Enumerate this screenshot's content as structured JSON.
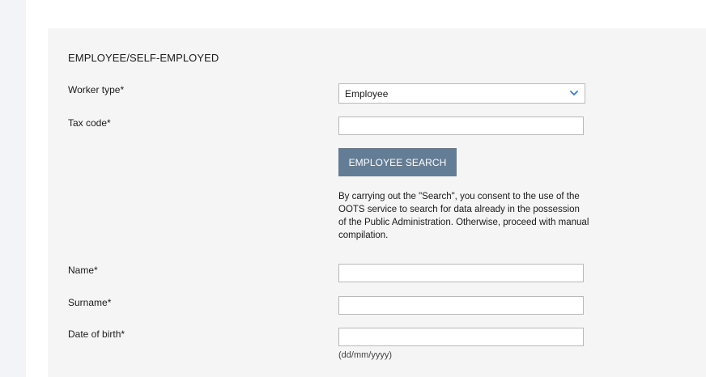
{
  "section": {
    "title": "EMPLOYEE/SELF-EMPLOYED"
  },
  "worker_type": {
    "label": "Worker type*",
    "selected": "Employee",
    "icon": "chevron-down-icon",
    "accent_color": "#3a7bd5"
  },
  "tax_code": {
    "label": "Tax code*",
    "value": "",
    "placeholder": ""
  },
  "search_button": {
    "label": "EMPLOYEE SEARCH",
    "color": "#647d96"
  },
  "search_notice": "By carrying out the \"Search\", you consent to the use of the OOTS service to search for data already in the possession of the Public Administration. Otherwise, proceed with manual compilation.",
  "name": {
    "label": "Name*",
    "value": ""
  },
  "surname": {
    "label": "Surname*",
    "value": ""
  },
  "date_of_birth": {
    "label": "Date of birth*",
    "value": "",
    "hint": "(dd/mm/yyyy)"
  }
}
